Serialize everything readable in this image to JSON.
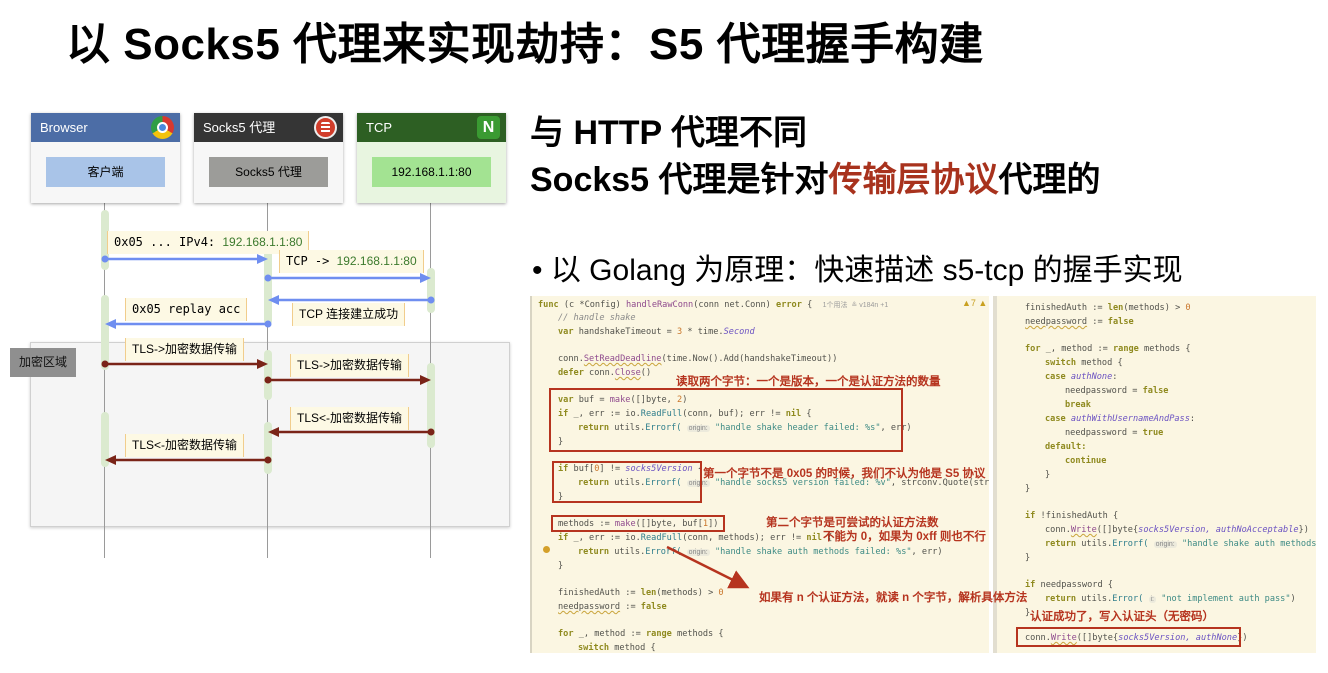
{
  "slide": {
    "title": "以 Socks5 代理来实现劫持：S5 代理握手构建"
  },
  "diagram": {
    "actors": [
      {
        "name": "Browser",
        "body": "客户端",
        "icon": "chrome-icon",
        "header_color": "#4c6da6",
        "body_color": "#a9c4e8"
      },
      {
        "name": "Socks5 代理",
        "body": "Socks5 代理",
        "icon": "database-icon",
        "header_color": "#353535",
        "body_color": "#9c9c99"
      },
      {
        "name": "TCP",
        "body": "192.168.1.1:80",
        "icon": "nginx-icon",
        "header_color": "#2d5f23",
        "body_color": "#a3e392"
      }
    ],
    "messages": [
      {
        "prefix": "0x05 ... IPv4: ",
        "ip": "192.168.1.1:80",
        "from": "Browser",
        "to": "Socks5 代理",
        "color": "#6f8ef0"
      },
      {
        "prefix": "TCP -> ",
        "ip": "192.168.1.1:80",
        "from": "Socks5 代理",
        "to": "TCP",
        "color": "#6f8ef0"
      },
      {
        "label": "TCP 连接建立成功",
        "from": "TCP",
        "to": "Socks5 代理",
        "color": "#6f8ef0"
      },
      {
        "label": "0x05 replay acc",
        "from": "Socks5 代理",
        "to": "Browser",
        "color": "#6f8ef0"
      },
      {
        "label": "TLS->加密数据传输",
        "from": "Browser",
        "to": "Socks5 代理",
        "color": "#7a2418"
      },
      {
        "label": "TLS->加密数据传输",
        "from": "Socks5 代理",
        "to": "TCP",
        "color": "#7a2418"
      },
      {
        "label": "TLS<-加密数据传输",
        "from": "TCP",
        "to": "Socks5 代理",
        "color": "#7a2418"
      },
      {
        "label": "TLS<-加密数据传输",
        "from": "Socks5 代理",
        "to": "Browser",
        "color": "#7a2418"
      }
    ],
    "region_label": "加密区域"
  },
  "right": {
    "subhead_line1": "与 HTTP 代理不同",
    "subhead_line2_pre": "Socks5 代理是针对",
    "subhead_line2_hl": "传输层协议",
    "subhead_line2_post": "代理的",
    "highlight_color": "#a8321d",
    "bullet": "• 以 Golang 为原理：快速描述 s5-tcp 的握手实现"
  },
  "code_left": {
    "usage_meta": "1个用法  ≗ v184n +1",
    "warnings": "▲7 ▲",
    "hint_origin": "origin:",
    "lines": {
      "l1_func": "func",
      "l1_recv": " (c *Config) ",
      "l1_name": "handleRawConn",
      "l1_params": "(conn net.Conn) ",
      "l1_err": "error",
      "l1_brace": " {",
      "l2": "// handle shake",
      "l3_var": "var",
      "l3_rest": " handshakeTimeout = ",
      "l3_num": "3",
      "l3_tail": " * time.",
      "l3_second": "Second",
      "l5_a": "conn.",
      "l5_b": "SetReadDeadline",
      "l5_c": "(time.Now().Add(handshakeTimeout))",
      "l6_a": "defer",
      "l6_b": " conn.",
      "l6_c": "Close",
      "l6_d": "()",
      "l8_a": "var",
      "l8_b": " buf = ",
      "l8_c": "make",
      "l8_d": "([]byte, ",
      "l8_e": "2",
      "l8_f": ")",
      "l9_a": "if",
      "l9_b": " _, err := io.",
      "l9_c": "ReadFull",
      "l9_d": "(conn, buf); err != ",
      "l9_e": "nil",
      "l9_f": " {",
      "l10_a": "return",
      "l10_b": " utils.",
      "l10_c": "Errorf(",
      "l10_str": "\"handle shake header failed: %s\"",
      "l10_tail": ", err)",
      "close": "}",
      "l13_a": "if",
      "l13_b": " buf[",
      "l13_c": "0",
      "l13_d": "] != ",
      "l13_e": "socks5Version",
      "l13_f": " {",
      "l14_str": "\"handle socks5 version failed: %v\"",
      "l14_tail": ", strconv.Quote(strin",
      "l17_a": "methods := ",
      "l17_b": "make",
      "l17_c": "([]byte, buf[",
      "l17_d": "1",
      "l17_e": "])",
      "l18_d": "(conn, methods); err != ",
      "l19_str": "\"handle shake auth methods failed: %s\"",
      "l22_a": "finishedAuth := ",
      "l22_b": "len",
      "l22_c": "(methods) > ",
      "l22_d": "0",
      "l23_a": "needpassword",
      "l23_b": " := ",
      "l23_c": "false",
      "l25_a": "for",
      "l25_b": " _, method := ",
      "l25_c": "range",
      "l25_d": " methods {",
      "l26_a": "switch",
      "l26_b": " method {"
    }
  },
  "code_right": {
    "lines": {
      "r1_a": "finishedAuth := ",
      "r1_b": "len",
      "r1_c": "(methods) > ",
      "r1_d": "0",
      "r2_a": "needpassword",
      "r2_b": " := ",
      "r2_c": "false",
      "r4_a": "for",
      "r4_b": " _, method := ",
      "r4_c": "range",
      "r4_d": " methods {",
      "r5_a": "switch",
      "r5_b": " method {",
      "r6_a": "case",
      "r6_b": "authNone",
      "r6_c": ":",
      "r7_a": "needpassword = ",
      "r7_b": "false",
      "r8": "break",
      "r9_b": "authWithUsernameAndPass",
      "r10_b": "true",
      "r11": "default:",
      "r12": "continue",
      "close": "}",
      "r15_a": "if",
      "r15_b": " !finishedAuth {",
      "r16_a": "conn.",
      "r16_b": "Write",
      "r16_c": "([]byte{",
      "r16_d": "socks5Version, authNoAcceptable",
      "r16_e": "})",
      "r17_a": "return",
      "r17_b": " utils.",
      "r17_c": "Errorf(",
      "r17_hint": "origin:",
      "r17_str": "\"handle shake auth methods fa",
      "r19_a": "if",
      "r19_b": " needpassword {",
      "r20_c": "Error(",
      "r20_hint": "i:",
      "r20_str": "\"not implement auth pass\"",
      "r20_tail": ")",
      "r22_d": "socks5Version, authNone"
    }
  },
  "annotations": {
    "a1": "读取两个字节：一个是版本，一个是认证方法的数量",
    "a2": "第一个字节不是 0x05 的时候，我们不认为他是 S5 协议",
    "a3": "第二个字节是可尝试的认证方法数",
    "a4": "不能为 0，如果为 0xff 则也不行",
    "a5": "如果有 n 个认证方法，就读 n 个字节，解析具体方法",
    "a6": "认证成功了，写入认证头（无密码）",
    "color": "#b6341f"
  }
}
